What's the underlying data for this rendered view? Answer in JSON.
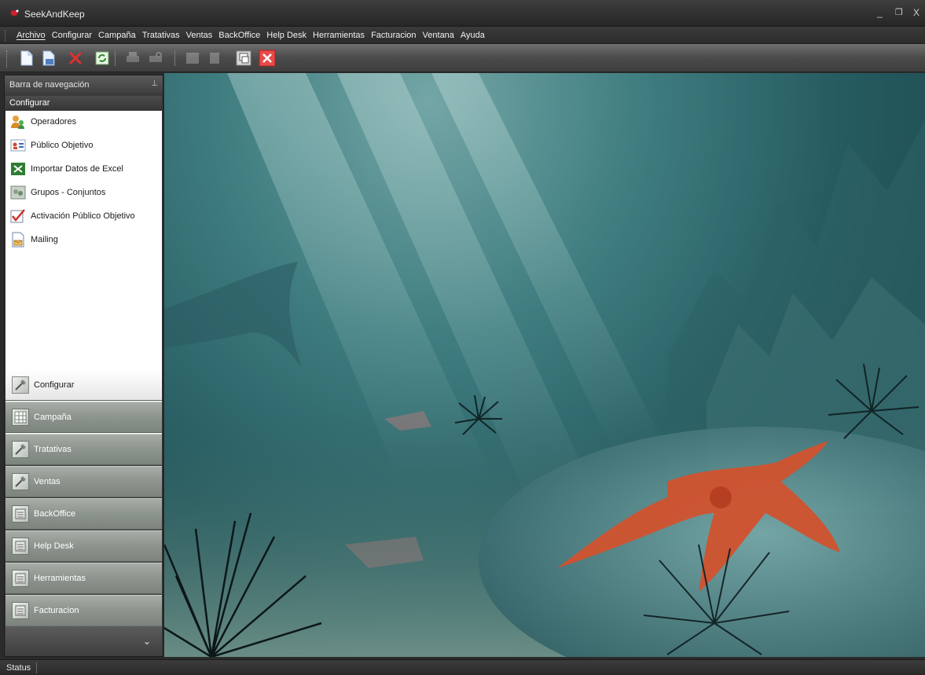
{
  "window": {
    "title": "SeekAndKeep",
    "controls": {
      "minimize": "_",
      "restore": "❐",
      "close": "X"
    }
  },
  "menubar": {
    "items": [
      "Archivo",
      "Configurar",
      "Campaña",
      "Tratativas",
      "Ventas",
      "BackOffice",
      "Help Desk",
      "Herramientas",
      "Facturacion",
      "Ventana",
      "Ayuda"
    ]
  },
  "toolbar": {
    "buttons": [
      {
        "name": "new",
        "icon": "new-document-icon",
        "enabled": true
      },
      {
        "name": "save",
        "icon": "save-icon",
        "enabled": true
      },
      {
        "name": "delete",
        "icon": "delete-x-icon",
        "enabled": true
      },
      {
        "name": "refresh",
        "icon": "refresh-icon",
        "enabled": true
      },
      {
        "name": "print",
        "icon": "print-icon",
        "enabled": false
      },
      {
        "name": "print-preview",
        "icon": "print-preview-icon",
        "enabled": false
      },
      {
        "name": "export",
        "icon": "export-icon",
        "enabled": false
      },
      {
        "name": "copy",
        "icon": "copy-icon",
        "enabled": false
      },
      {
        "name": "windows",
        "icon": "windows-icon",
        "enabled": true
      },
      {
        "name": "close",
        "icon": "close-red-icon",
        "enabled": true
      }
    ]
  },
  "navigation": {
    "header": "Barra de navegación",
    "active_group": "Configurar",
    "group_items": [
      {
        "label": "Operadores",
        "icon": "operators-icon"
      },
      {
        "label": "Público Objetivo",
        "icon": "target-audience-icon"
      },
      {
        "label": "Importar Datos de Excel",
        "icon": "excel-import-icon"
      },
      {
        "label": "Grupos - Conjuntos",
        "icon": "groups-icon"
      },
      {
        "label": "Activación Público Objetivo",
        "icon": "checkmark-icon"
      },
      {
        "label": "Mailing",
        "icon": "mailing-icon"
      }
    ],
    "buttons": [
      {
        "label": "Configurar",
        "active": true
      },
      {
        "label": "Campaña",
        "active": false
      },
      {
        "label": "Tratativas",
        "active": false
      },
      {
        "label": "Ventas",
        "active": false
      },
      {
        "label": "BackOffice",
        "active": false
      },
      {
        "label": "Help Desk",
        "active": false
      },
      {
        "label": "Herramientas",
        "active": false
      },
      {
        "label": "Facturacion",
        "active": false
      }
    ],
    "overflow_icon": "chevron-down-icon"
  },
  "statusbar": {
    "text": "Status"
  }
}
